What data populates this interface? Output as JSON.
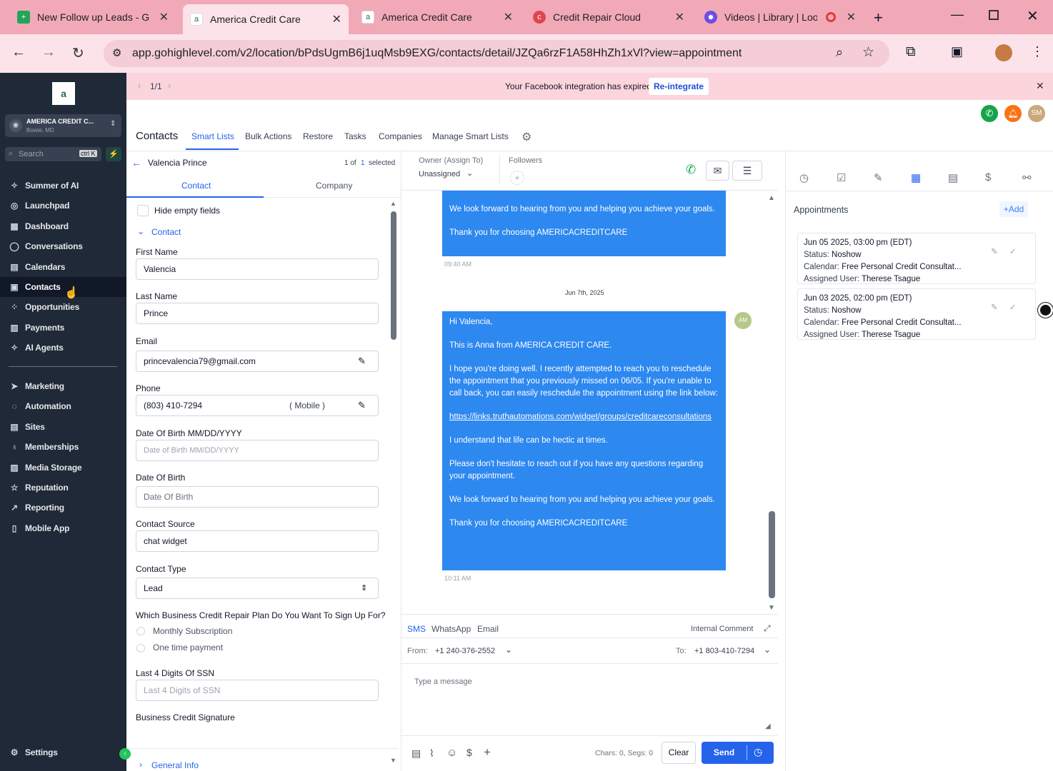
{
  "browser": {
    "tabs": [
      {
        "title": "New Follow up Leads - G",
        "color": "#22a559",
        "glyph": "+"
      },
      {
        "title": "America Credit Care",
        "color": "#ffffff",
        "glyph": "a"
      },
      {
        "title": "America Credit Care",
        "color": "#ffffff",
        "glyph": "a"
      },
      {
        "title": "Credit Repair Cloud",
        "color": "#e0464d",
        "glyph": "c"
      },
      {
        "title": "Videos | Library | Loo",
        "color": "#6b4ce6",
        "glyph": "✹"
      }
    ],
    "url": "app.gohighlevel.com/v2/location/bPdsUgmB6j1uqMsb9EXG/contacts/detail/JZQa6rzF1A58HhZh1xVl?view=appointment"
  },
  "sidebar": {
    "account_name": "AMERICA CREDIT C...",
    "account_location": "Bowie, MD",
    "search_placeholder": "Search",
    "search_shortcut": "ctrl K",
    "items": [
      {
        "label": "Summer of AI",
        "icon": "✧"
      },
      {
        "label": "Launchpad",
        "icon": "◎"
      },
      {
        "label": "Dashboard",
        "icon": "▦"
      },
      {
        "label": "Conversations",
        "icon": "◯"
      },
      {
        "label": "Calendars",
        "icon": "▤"
      },
      {
        "label": "Contacts",
        "icon": "▣"
      },
      {
        "label": "Opportunities",
        "icon": "⁘"
      },
      {
        "label": "Payments",
        "icon": "▥"
      },
      {
        "label": "AI Agents",
        "icon": "✧"
      }
    ],
    "items2": [
      {
        "label": "Marketing",
        "icon": "➤"
      },
      {
        "label": "Automation",
        "icon": "◌"
      },
      {
        "label": "Sites",
        "icon": "▤"
      },
      {
        "label": "Memberships",
        "icon": "♁"
      },
      {
        "label": "Media Storage",
        "icon": "▨"
      },
      {
        "label": "Reputation",
        "icon": "☆"
      },
      {
        "label": "Reporting",
        "icon": "↗"
      },
      {
        "label": "Mobile App",
        "icon": "▯"
      }
    ],
    "settings": "Settings"
  },
  "banner": {
    "pager": "1/1",
    "message": "Your Facebook integration has expired.",
    "button": "Re-integrate"
  },
  "header": {
    "avatar": "SM",
    "tabs": [
      "Contacts",
      "Smart Lists",
      "Bulk Actions",
      "Restore",
      "Tasks",
      "Companies",
      "Manage Smart Lists"
    ]
  },
  "contact": {
    "name": "Valencia Prince",
    "count_1": "1 of",
    "count_2": "1",
    "count_3": "selected",
    "tab_contact": "Contact",
    "tab_company": "Company",
    "hide_empty": "Hide empty fields",
    "section": "Contact",
    "first_name_label": "First Name",
    "first_name": "Valencia",
    "last_name_label": "Last Name",
    "last_name": "Prince",
    "email_label": "Email",
    "email": "princevalencia79@gmail.com",
    "phone_label": "Phone",
    "phone": "(803) 410-7294",
    "phone_type": "( Mobile )",
    "dob_mm_label": "Date Of Birth MM/DD/YYYY",
    "dob_mm_ph": "Date of Birth MM/DD/YYYY",
    "dob_label": "Date Of Birth",
    "dob_ph": "Date Of Birth",
    "source_label": "Contact Source",
    "source": "chat widget",
    "type_label": "Contact Type",
    "type": "Lead",
    "plan_q": "Which Business Credit Repair Plan Do You Want To Sign Up For?",
    "plan_1": "Monthly Subscription",
    "plan_2": "One time payment",
    "ssn_label": "Last 4 Digits Of SSN",
    "ssn_ph": "Last 4 Digits of SSN",
    "sig_label": "Business Credit Signature",
    "general": "General Info"
  },
  "conversation": {
    "owner_label": "Owner (Assign To)",
    "owner": "Unassigned",
    "followers_label": "Followers",
    "msg1": [
      "We look forward to hearing from you and helping you achieve your goals.",
      "Thank you for choosing AMERICACREDITCARE"
    ],
    "time1": "09:40 AM",
    "date_divider": "Jun 7th, 2025",
    "avatar": "AM",
    "msg2": [
      "Hi Valencia,",
      "This is Anna from AMERICA CREDIT CARE.",
      "I hope you're doing well. I recently attempted to reach you to reschedule the appointment that you previously missed on 06/05. If you're unable to call back, you can easily reschedule the appointment using the link below:",
      "https://links.truthautomations.com/widget/groups/creditcareconsultations",
      "I understand that life can be hectic at times.",
      "Please don't hesitate to reach out if you have any questions regarding your appointment.",
      "We look forward to hearing from you and helping you achieve your goals.",
      "Thank you for choosing AMERICACREDITCARE"
    ],
    "time2": "10:11 AM",
    "channels": [
      "SMS",
      "WhatsApp",
      "Email"
    ],
    "internal": "Internal Comment",
    "from_label": "From:",
    "from": "+1 240-376-2552",
    "to_label": "To:",
    "to": "+1 803-410-7294",
    "placeholder": "Type a message",
    "chars": "Chars: 0, Segs: 0",
    "clear": "Clear",
    "send": "Send"
  },
  "appointments": {
    "title": "Appointments",
    "add": "Add",
    "status_label": "Status:",
    "calendar_label": "Calendar:",
    "user_label": "Assigned User:",
    "items": [
      {
        "date": "Jun 05 2025, 03:00 pm (EDT)",
        "status": "Noshow",
        "calendar": "Free Personal Credit Consultat...",
        "user": "Therese Tsague"
      },
      {
        "date": "Jun 03 2025, 02:00 pm (EDT)",
        "status": "Noshow",
        "calendar": "Free Personal Credit Consultat...",
        "user": "Therese Tsague"
      }
    ]
  },
  "colors": {
    "accent": "#2563eb",
    "sidebar": "#1f2937",
    "bubble": "#2d88f0",
    "tabbar": "#f1a9b8"
  }
}
